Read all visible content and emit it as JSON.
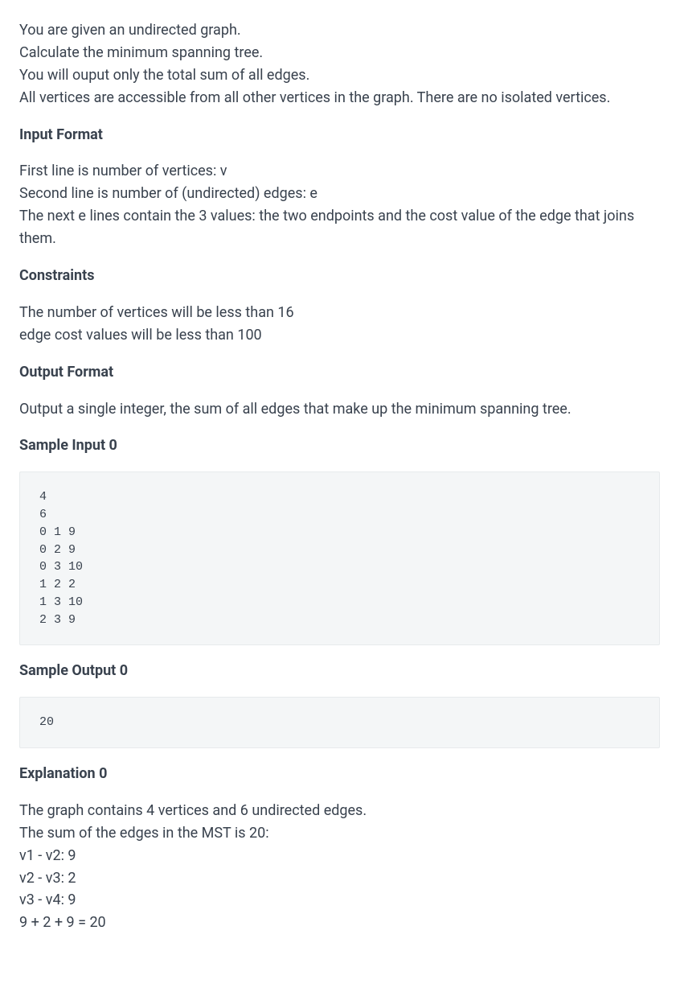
{
  "intro": {
    "l1": "You are given an undirected graph.",
    "l2": "Calculate the minimum spanning tree.",
    "l3": "You will ouput only the total sum of all edges.",
    "l4": "All vertices are accessible from all other vertices in the graph. There are no isolated vertices."
  },
  "input_format": {
    "heading": "Input Format",
    "l1": "First line is number of vertices: v",
    "l2": "Second line is number of (undirected) edges: e",
    "l3": "The next e lines contain the 3 values: the two endpoints and the cost value of the edge that joins them."
  },
  "constraints": {
    "heading": "Constraints",
    "l1": "The number of vertices will be less than 16",
    "l2": "edge cost values will be less than 100"
  },
  "output_format": {
    "heading": "Output Format",
    "l1": "Output a single integer, the sum of all edges that make up the minimum spanning tree."
  },
  "sample_input": {
    "heading": "Sample Input 0",
    "code": "4\n6\n0 1 9\n0 2 9\n0 3 10\n1 2 2\n1 3 10\n2 3 9"
  },
  "sample_output": {
    "heading": "Sample Output 0",
    "code": "20"
  },
  "explanation": {
    "heading": "Explanation 0",
    "l1": "The graph contains 4 vertices and 6 undirected edges.",
    "l2": "The sum of the edges in the MST is 20:",
    "l3": "v1 - v2: 9",
    "l4": "v2 - v3: 2",
    "l5": "v3 - v4: 9",
    "l6": "9 + 2 + 9 = 20"
  }
}
